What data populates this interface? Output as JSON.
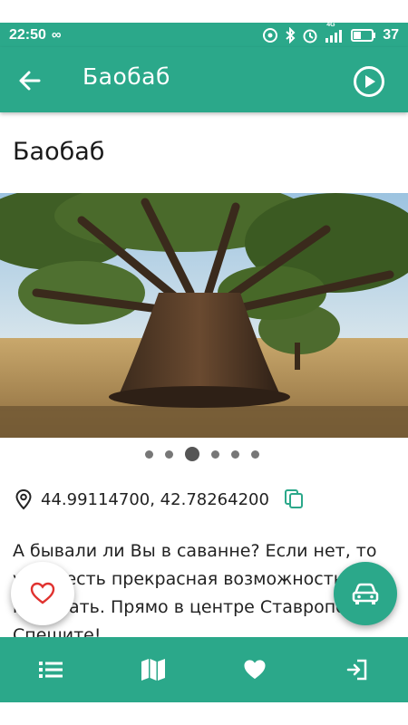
{
  "status_bar": {
    "time": "22:50",
    "loop_glyph": "∞",
    "network": "4G",
    "battery": "37"
  },
  "app_bar": {
    "title": "Баобаб",
    "back_icon": "arrow-left-icon",
    "action_icon": "play-circle-icon"
  },
  "page": {
    "title": "Баобаб"
  },
  "gallery": {
    "photo_count": 6,
    "active_index": 2
  },
  "location": {
    "coordinates": "44.99114700, 42.78264200",
    "pin_icon": "map-pin-icon",
    "copy_icon": "copy-icon"
  },
  "description": {
    "text": "А бывали ли Вы в саванне? Если нет, то у Вас есть прекрасная возможность там побывать. Прямо в центре Ставрополья. Спешите!"
  },
  "fabs": {
    "favorite_icon": "heart-outline-icon",
    "route_icon": "car-icon"
  },
  "bottom_nav": {
    "items": [
      "list-icon",
      "map-icon",
      "heart-icon",
      "exit-icon"
    ]
  },
  "colors": {
    "primary": "#2ba88a",
    "accent_heart": "#e0322f"
  }
}
